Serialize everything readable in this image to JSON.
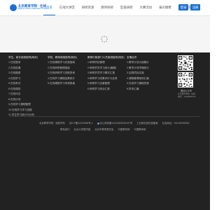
{
  "header": {
    "logo_cn": "北京教育学院 · 在线",
    "logo_en": "Beijing Institute of Education Online",
    "nav": [
      "首页",
      "在线大讲堂",
      "研修资源",
      "教师研修",
      "区级研修",
      "大赛活动",
      "报名缴费",
      "政策资讯"
    ],
    "login_label": "登录",
    "register_label": "注册"
  },
  "footer": {
    "columns": [
      {
        "title": "学生、家长使用指导(网页)",
        "links": [
          "1.在线登录",
          "2.在线选课",
          "3.在线缴费",
          "4.在线学习",
          "5.在线考试",
          "6.在线调查",
          "7.在线评议",
          "8.在线计划",
          "9.在线学习课程管理",
          "10.在线学习学习进程",
          "11.学生学习统计与分析"
        ]
      },
      {
        "title": "学校、教师使用指导(网页)",
        "links": [
          "1.在线课程学习实施指南",
          "2.在线研修管理指南",
          "3.在线研修学习进程查询",
          "4.在线学习课程结果统计",
          "5.在线课程学习申请表格"
        ]
      },
      {
        "title": "教育行政部门人员使用指导(网页)",
        "links": [
          "1.研修项目管理",
          "2.研修学员学习统计(截图)",
          "3.研修学员学习情况汇报",
          "4.研修学习成果评价与反馈",
          "5.研修学习全景管理",
          "6.研修学习综合汇报"
        ]
      },
      {
        "title": "友情合作",
        "links": [
          "1.教学计划大纲展示",
          "2.教学计划学期统计",
          "3.实践项目实施",
          "4.课程管理案例汇编",
          "5.在线学习课程资源",
          "6.样本汇编"
        ]
      }
    ],
    "qr": {
      "caption": "微信公众号",
      "sub1": "北京教育学院 · 在线",
      "sub2": "电话：13436895752"
    },
    "legal_row1": [
      "北京教育学院 · 版权所有",
      "京ICP备11007868号-1",
      "京公网安备11010502030437号",
      "工业和信息化部备案",
      "社会网址：010-52095352"
    ],
    "legal_row2": [
      "联系我们",
      "北京大学图书馆",
      "北京市教育委员会",
      "中国教育网",
      "中国教师网"
    ]
  }
}
